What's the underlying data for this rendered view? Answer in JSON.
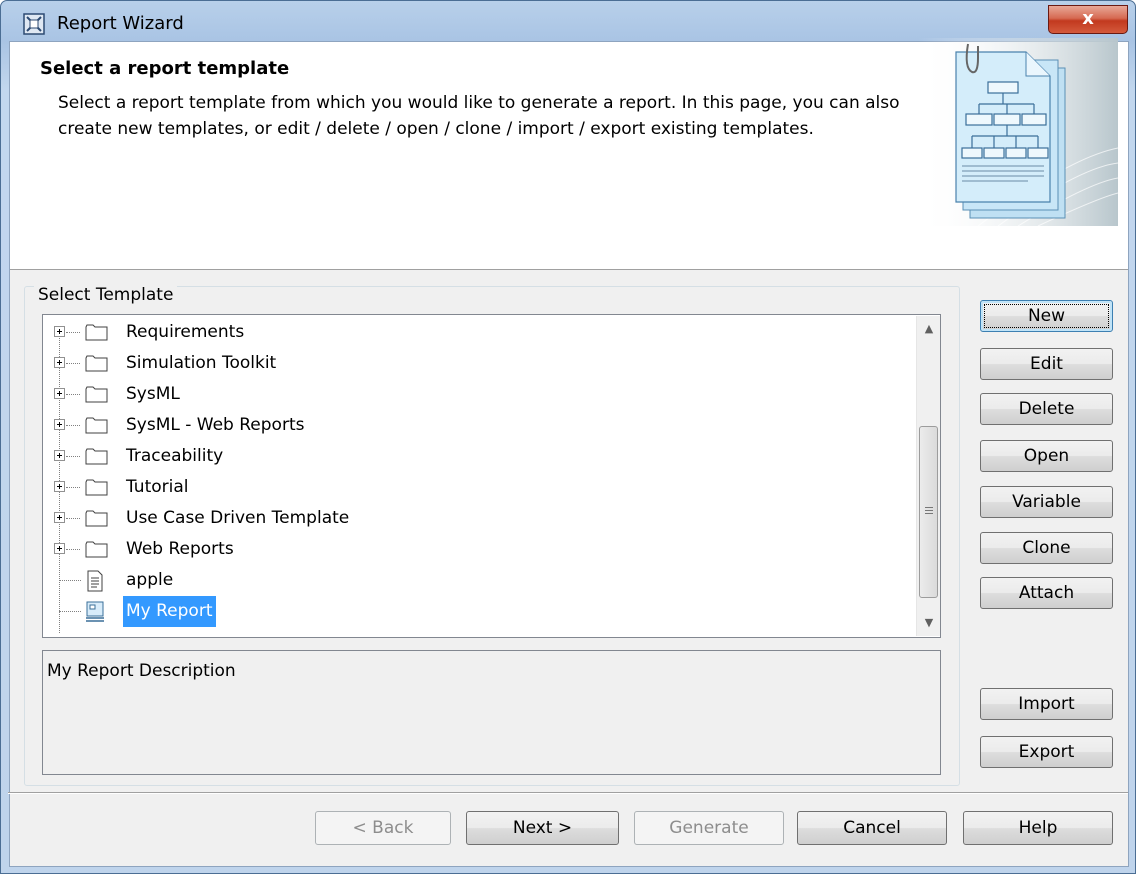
{
  "window": {
    "title": "Report Wizard",
    "close_label": "x"
  },
  "header": {
    "title": "Select a report template",
    "description": "Select a report template from which you would like to generate a report. In this page, you can also create new templates, or edit / delete / open / clone / import / export existing templates."
  },
  "template_group": {
    "label": "Select Template"
  },
  "tree": {
    "items": [
      {
        "label": "Requirements",
        "type": "folder"
      },
      {
        "label": "Simulation Toolkit",
        "type": "folder"
      },
      {
        "label": "SysML",
        "type": "folder"
      },
      {
        "label": "SysML - Web Reports",
        "type": "folder"
      },
      {
        "label": "Traceability",
        "type": "folder"
      },
      {
        "label": "Tutorial",
        "type": "folder"
      },
      {
        "label": "Use Case Driven Template",
        "type": "folder"
      },
      {
        "label": "Web Reports",
        "type": "folder"
      },
      {
        "label": "apple",
        "type": "document"
      },
      {
        "label": "My Report",
        "type": "report",
        "selected": true
      }
    ],
    "scroll_grip": "≡"
  },
  "description": {
    "text": "My Report Description"
  },
  "side_buttons": {
    "new": "New",
    "edit": "Edit",
    "delete": "Delete",
    "open": "Open",
    "variable": "Variable",
    "clone": "Clone",
    "attach": "Attach",
    "import": "Import",
    "export": "Export"
  },
  "footer_buttons": {
    "back": "< Back",
    "next": "Next >",
    "generate": "Generate",
    "cancel": "Cancel",
    "help": "Help"
  },
  "colors": {
    "selection": "#3399ff",
    "title_bar": "#b8d0ea",
    "close": "#c2391f"
  }
}
